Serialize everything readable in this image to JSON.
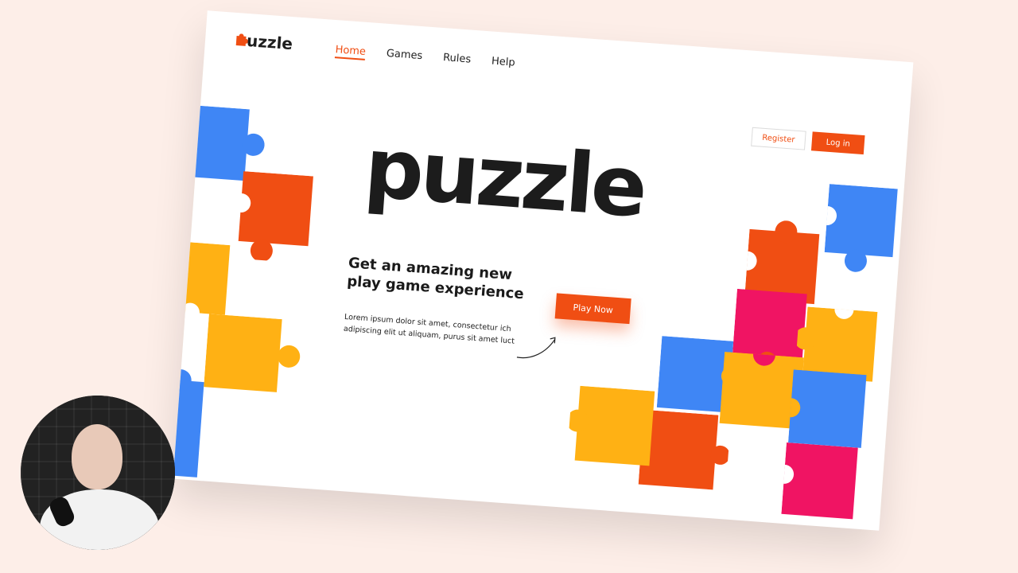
{
  "logo": {
    "text": "uzzle",
    "mark_icon": "puzzle-piece-icon"
  },
  "nav": [
    {
      "label": "Home",
      "active": true
    },
    {
      "label": "Games",
      "active": false
    },
    {
      "label": "Rules",
      "active": false
    },
    {
      "label": "Help",
      "active": false
    }
  ],
  "auth": {
    "register_label": "Register",
    "login_label": "Log in"
  },
  "hero": {
    "title": "puzzle",
    "subhead_line1": "Get an amazing new",
    "subhead_line2": "play game experience",
    "desc_line1": "Lorem ipsum dolor sit amet, consectetur ich",
    "desc_line2": "adipiscing elit ut aliquam, purus sit amet luct",
    "cta_label": "Play Now"
  },
  "colors": {
    "brand_orange": "#f04e13",
    "blue": "#3f86f5",
    "yellow": "#ffb114",
    "magenta": "#f01463",
    "text_dark": "#1c1c1c",
    "background": "#fdeee8"
  }
}
